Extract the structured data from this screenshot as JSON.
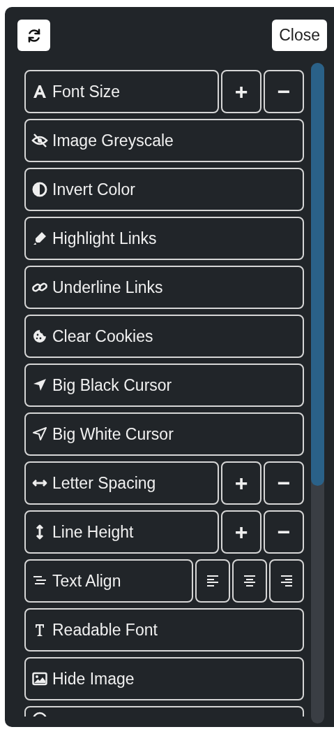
{
  "header": {
    "close": "Close"
  },
  "items": [
    {
      "kind": "stepper",
      "label": "Font Size",
      "increase": "+",
      "decrease": "−"
    },
    {
      "kind": "toggle",
      "label": "Image Greyscale"
    },
    {
      "kind": "toggle",
      "label": "Invert Color"
    },
    {
      "kind": "toggle",
      "label": "Highlight Links"
    },
    {
      "kind": "toggle",
      "label": "Underline Links"
    },
    {
      "kind": "toggle",
      "label": "Clear Cookies"
    },
    {
      "kind": "toggle",
      "label": "Big Black Cursor"
    },
    {
      "kind": "toggle",
      "label": "Big White Cursor"
    },
    {
      "kind": "stepper",
      "label": "Letter Spacing",
      "increase": "+",
      "decrease": "−"
    },
    {
      "kind": "stepper",
      "label": "Line Height",
      "increase": "+",
      "decrease": "−"
    },
    {
      "kind": "align",
      "label": "Text Align"
    },
    {
      "kind": "toggle",
      "label": "Readable Font"
    },
    {
      "kind": "toggle",
      "label": "Hide Image"
    },
    {
      "kind": "clipped"
    }
  ]
}
